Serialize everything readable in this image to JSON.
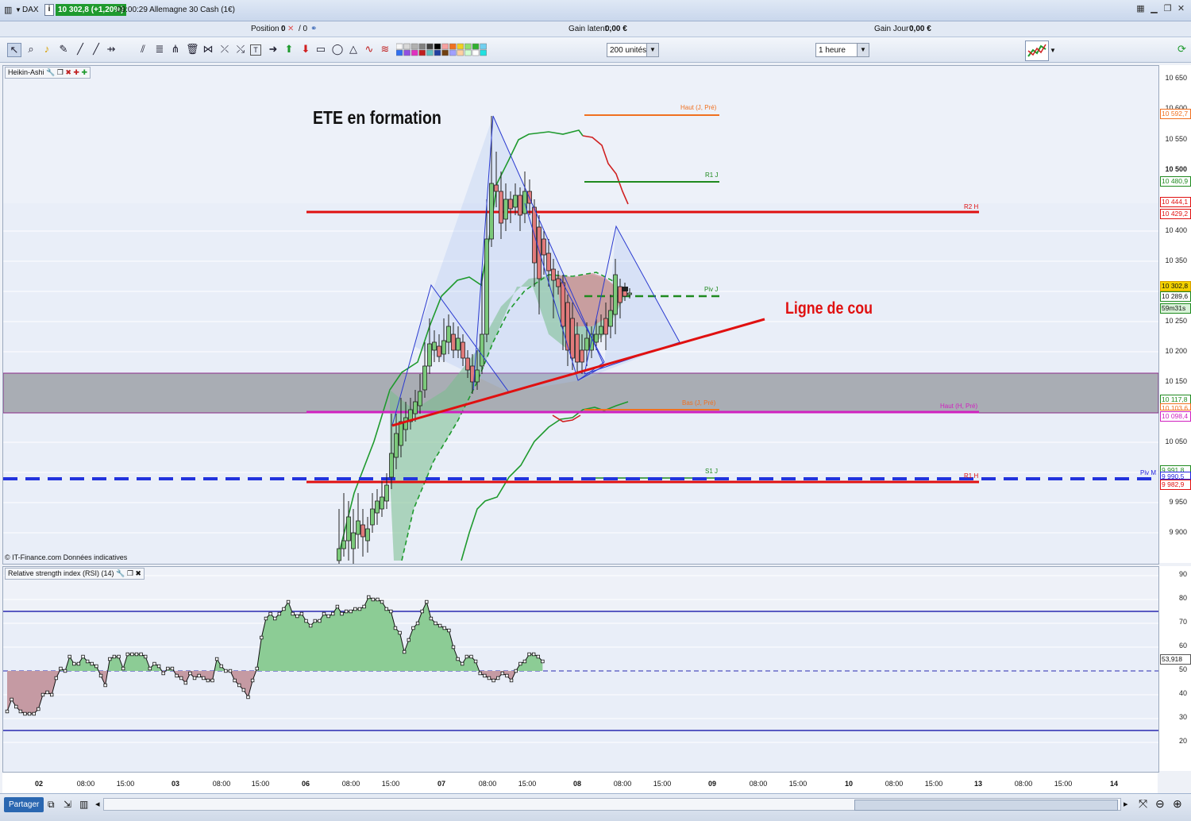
{
  "titlebar": {
    "symbol": "DAX",
    "quote": "10 302,8 (+1,20%)",
    "time_name": "09:00:29 Allemagne 30 Cash (1€)"
  },
  "infobar": {
    "position_label": "Position :",
    "position_value": "0",
    "position_value2": "/ 0",
    "latent_label": "Gain latent :",
    "latent_value": "0,00 €",
    "day_label": "Gain Jour :",
    "day_value": "0,00 €"
  },
  "toolbar": {
    "units_select": "200 unités",
    "period_select": "1 heure"
  },
  "main_panel": {
    "title": "Heikin-Ashi",
    "watermark": "© IT-Finance.com  Données indicatives",
    "annotation_title": "ETE en formation",
    "annotation_neckline": "Ligne de cou"
  },
  "levels": [
    {
      "label": "Haut (J, Pré)",
      "color": "#f07020"
    },
    {
      "label": "R1 J",
      "color": "#1f8a1f"
    },
    {
      "label": "R2 H",
      "color": "#e01010"
    },
    {
      "label": "Piv J",
      "color": "#1f8a1f"
    },
    {
      "label": "Bas (J, Pré)",
      "color": "#f07020"
    },
    {
      "label": "Haut (H, Pré)",
      "color": "#d020c0"
    },
    {
      "label": "S1 J",
      "color": "#1f8a1f"
    },
    {
      "label": "R1 H",
      "color": "#e01010"
    },
    {
      "label": "Piv M",
      "color": "#2222dd"
    }
  ],
  "price_axis": {
    "ticks": [
      "10 650",
      "10 600",
      "10 550",
      "10 500",
      "10 400",
      "10 350",
      "10 250",
      "10 200",
      "10 150",
      "10 050",
      "9 950",
      "9 900"
    ],
    "labels": [
      {
        "text": "10 592,7",
        "color": "#f07020"
      },
      {
        "text": "10 480,9",
        "color": "#1f8a1f"
      },
      {
        "text": "10 444,1",
        "color": "#e01010"
      },
      {
        "text": "10 429,2",
        "color": "#e01010"
      },
      {
        "text": "10 302,8",
        "color": "#111111"
      },
      {
        "text": "10 289,6",
        "color": "#1f8a1f"
      },
      {
        "text": "59m31s",
        "color": "#111111"
      },
      {
        "text": "10 117,8",
        "color": "#1f8a1f"
      },
      {
        "text": "10 103,6",
        "color": "#f07020"
      },
      {
        "text": "10 098,4",
        "color": "#d020c0"
      },
      {
        "text": "9 991,8",
        "color": "#1f8a1f"
      },
      {
        "text": "9 990,5",
        "color": "#2222dd"
      },
      {
        "text": "9 982,9",
        "color": "#e01010"
      }
    ]
  },
  "rsi_panel": {
    "title": "Relative strength index (RSI) (14)",
    "ticks": [
      "90",
      "80",
      "70",
      "60",
      "50",
      "40",
      "30",
      "20"
    ],
    "value_label": "53,918"
  },
  "time_axis": {
    "labels": [
      "02",
      "08:00",
      "15:00",
      "03",
      "08:00",
      "15:00",
      "06",
      "08:00",
      "15:00",
      "07",
      "08:00",
      "15:00",
      "08",
      "08:00",
      "15:00",
      "09",
      "08:00",
      "15:00",
      "10",
      "08:00",
      "15:00",
      "13",
      "08:00",
      "15:00",
      "14"
    ]
  },
  "statusbar": {
    "share_label": "Partager"
  },
  "colors": {
    "bull": "#7bc97a",
    "bear": "#e07a7a",
    "zone_grey": "#a9adb4",
    "rsi_up": "#8ccc95",
    "rsi_down": "#c59aa3"
  }
}
